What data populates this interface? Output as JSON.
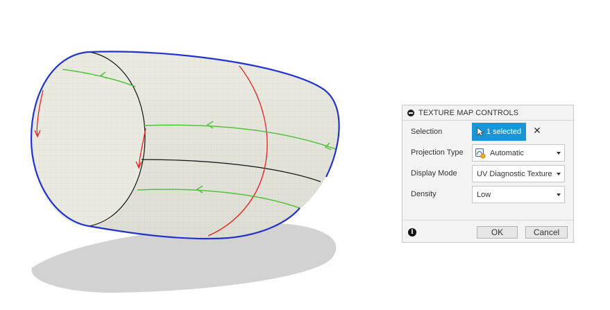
{
  "panel": {
    "title": "TEXTURE MAP CONTROLS",
    "selection": {
      "label": "Selection",
      "button_text": "1 selected"
    },
    "projection_type": {
      "label": "Projection Type",
      "value": "Automatic"
    },
    "display_mode": {
      "label": "Display Mode",
      "value": "UV Diagnostic Texture"
    },
    "density": {
      "label": "Density",
      "value": "Low"
    },
    "ok_label": "OK",
    "cancel_label": "Cancel"
  },
  "colors": {
    "accent": "#1a95d6",
    "boundary_edge": "#2233cc",
    "u_direction": "#55c040",
    "v_direction": "#e02020",
    "surface": "#e6e6dc"
  },
  "icons": [
    "collapse-icon",
    "cursor-icon",
    "clear-icon",
    "projection-icon",
    "chevron-down-icon",
    "info-icon"
  ]
}
